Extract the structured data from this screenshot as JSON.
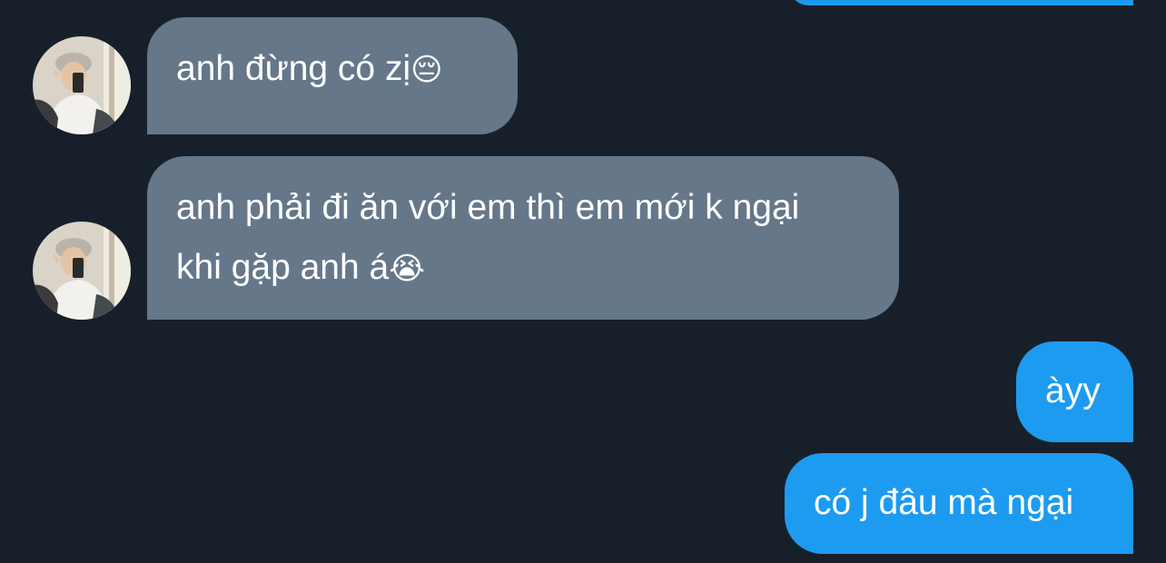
{
  "conversation": {
    "incoming": [
      {
        "text": "anh đừng có zị",
        "emoji": "😔",
        "emoji_name": "pensive-face-emoji"
      },
      {
        "line1": "anh phải đi ăn với em thì em mới k ngại",
        "line2": "khi gặp anh á",
        "emoji": "😭",
        "emoji_name": "loudly-crying-face-emoji"
      }
    ],
    "outgoing": [
      {
        "text": "àyy"
      },
      {
        "text": "có j đâu mà ngại"
      }
    ]
  },
  "colors": {
    "background": "#17202a",
    "incoming_bubble": "#66778a",
    "outgoing_bubble": "#1d9bf0",
    "text": "#ffffff"
  }
}
